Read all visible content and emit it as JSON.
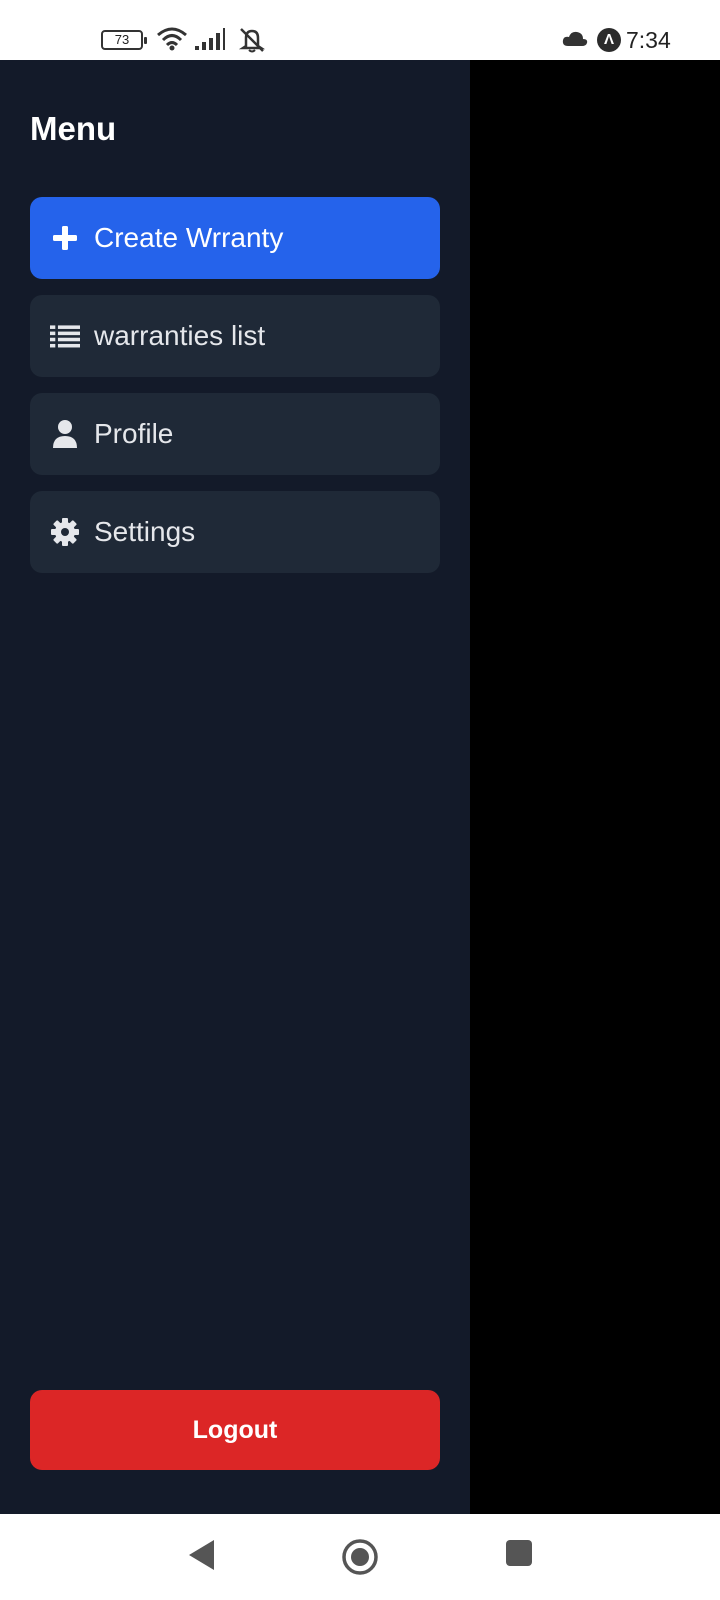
{
  "status_bar": {
    "battery_level": "73",
    "time": "7:34",
    "icons": [
      "battery-icon",
      "wifi-icon",
      "signal-icon",
      "silent-icon",
      "cloud-icon",
      "app-notification-icon"
    ]
  },
  "drawer": {
    "title": "Menu",
    "items": [
      {
        "label": "Create Wrranty",
        "icon": "plus-icon",
        "active": true
      },
      {
        "label": "warranties list",
        "icon": "list-icon",
        "active": false
      },
      {
        "label": "Profile",
        "icon": "user-icon",
        "active": false
      },
      {
        "label": "Settings",
        "icon": "gear-icon",
        "active": false
      }
    ],
    "logout_label": "Logout"
  },
  "colors": {
    "drawer_bg": "#131a29",
    "item_bg": "#1f2937",
    "active_item_bg": "#2563eb",
    "logout_bg": "#dc2626",
    "backdrop": "#000000"
  },
  "nav_bar": {
    "buttons": [
      "back-icon",
      "home-icon",
      "recents-icon"
    ]
  }
}
